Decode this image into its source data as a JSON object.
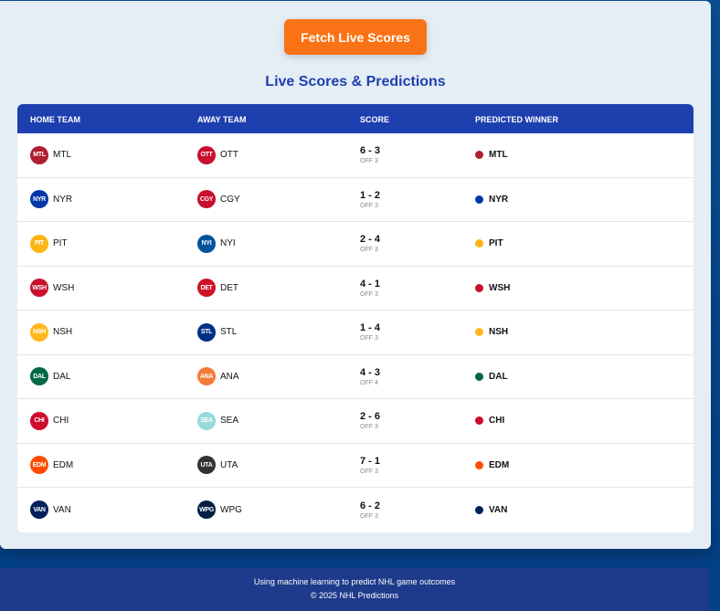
{
  "fetch_label": "Fetch Live Scores",
  "title": "Live Scores & Predictions",
  "headers": [
    "HOME TEAM",
    "AWAY TEAM",
    "SCORE",
    "PREDICTED WINNER"
  ],
  "games": [
    {
      "home": "MTL",
      "home_color": "#af1e2d",
      "away": "OTT",
      "away_color": "#c8102e",
      "score": "6 - 3",
      "status": "OFF 3",
      "winner": "MTL",
      "winner_color": "#af1e2d"
    },
    {
      "home": "NYR",
      "home_color": "#0038a8",
      "away": "CGY",
      "away_color": "#c8102e",
      "score": "1 - 2",
      "status": "OFF 3",
      "winner": "NYR",
      "winner_color": "#0038a8"
    },
    {
      "home": "PIT",
      "home_color": "#fcb514",
      "away": "NYI",
      "away_color": "#00539b",
      "score": "2 - 4",
      "status": "OFF 3",
      "winner": "PIT",
      "winner_color": "#fcb514"
    },
    {
      "home": "WSH",
      "home_color": "#c8102e",
      "away": "DET",
      "away_color": "#ce1126",
      "score": "4 - 1",
      "status": "OFF 3",
      "winner": "WSH",
      "winner_color": "#c8102e"
    },
    {
      "home": "NSH",
      "home_color": "#ffb81c",
      "away": "STL",
      "away_color": "#002f87",
      "score": "1 - 4",
      "status": "OFF 3",
      "winner": "NSH",
      "winner_color": "#ffb81c"
    },
    {
      "home": "DAL",
      "home_color": "#006847",
      "away": "ANA",
      "away_color": "#f47a38",
      "score": "4 - 3",
      "status": "OFF 4",
      "winner": "DAL",
      "winner_color": "#006847"
    },
    {
      "home": "CHI",
      "home_color": "#cf0a2c",
      "away": "SEA",
      "away_color": "#99d9d9",
      "score": "2 - 6",
      "status": "OFF 3",
      "winner": "CHI",
      "winner_color": "#cf0a2c"
    },
    {
      "home": "EDM",
      "home_color": "#ff4c00",
      "away": "UTA",
      "away_color": "#333333",
      "score": "7 - 1",
      "status": "OFF 3",
      "winner": "EDM",
      "winner_color": "#ff4c00"
    },
    {
      "home": "VAN",
      "home_color": "#00205b",
      "away": "WPG",
      "away_color": "#041e42",
      "score": "6 - 2",
      "status": "OFF 3",
      "winner": "VAN",
      "winner_color": "#00205b"
    }
  ],
  "footer": {
    "tagline": "Using machine learning to predict NHL game outcomes",
    "copyright": "© 2025 NHL Predictions"
  }
}
